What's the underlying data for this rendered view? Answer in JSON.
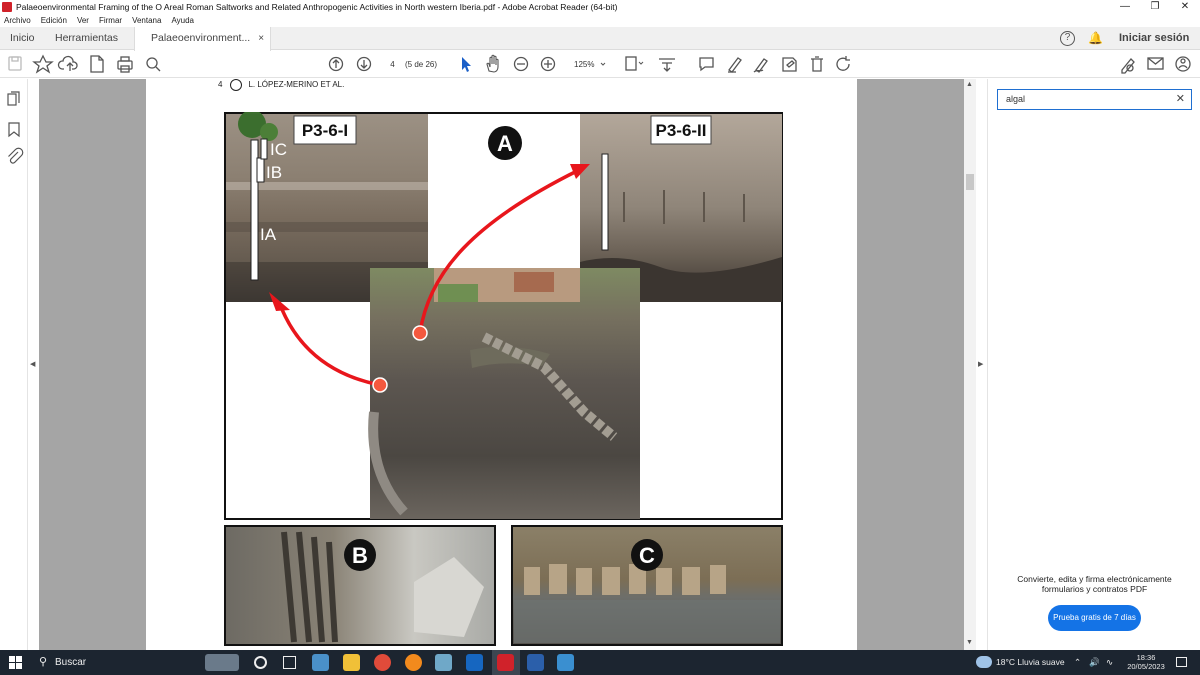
{
  "window": {
    "title": "Palaeoenvironmental Framing of the O Areal Roman Saltworks and Related Anthropogenic Activities in North western Iberia.pdf - Adobe Acrobat Reader (64-bit)",
    "controls": [
      "minimize-icon",
      "restore-icon",
      "close-icon"
    ]
  },
  "menu": [
    "Archivo",
    "Edición",
    "Ver",
    "Firmar",
    "Ventana",
    "Ayuda"
  ],
  "tabs": {
    "home": "Inicio",
    "tools": "Herramientas",
    "doc": "Palaeoenvironment...",
    "close": "×"
  },
  "header": {
    "help": "?",
    "signin": "Iniciar sesión"
  },
  "toolbar": {
    "page_value": "4",
    "page_count": "(5 de 26)",
    "zoom": "125%"
  },
  "document": {
    "page_number": "4",
    "running_head": "L. LÓPEZ-MERINO ET AL.",
    "figure": {
      "panel_a_label": "A",
      "panel_b_label": "B",
      "panel_c_label": "C",
      "photo1_label": "P3-6-I",
      "photo2_label": "P3-6-II",
      "layer_ic": "IC",
      "layer_ib": "IB",
      "layer_ia": "IA"
    }
  },
  "sidepanel": {
    "search_value": "algal",
    "promo_line1": "Convierte, edita y firma electrónicamente",
    "promo_line2": "formularios y contratos PDF",
    "trial_button": "Prueba gratis de 7 días"
  },
  "taskbar": {
    "search": "Buscar",
    "weather": "18°C  Lluvia suave",
    "time": "18:36",
    "date": "20/05/2023"
  },
  "colors": {
    "accent": "#1473e6",
    "arrow_red": "#e8161c",
    "doc_background": "#a5a5a5",
    "taskbar": "#1c2530"
  }
}
